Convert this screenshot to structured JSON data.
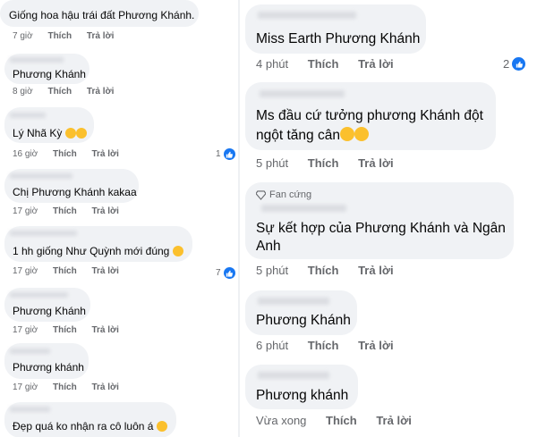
{
  "actions": {
    "like": "Thích",
    "reply": "Trả lời"
  },
  "left_comments": [
    {
      "text": "Giống hoa hậu trái đất Phương Khánh.",
      "time": "7 giờ"
    },
    {
      "text": "Phương Khánh",
      "time": "8 giờ"
    },
    {
      "text": "Lý Nhã Kỳ",
      "time": "16 giờ",
      "reactions": "1"
    },
    {
      "text": "Chị Phương Khánh kakaa",
      "time": "17 giờ"
    },
    {
      "text": "1 hh giống Như Quỳnh mới đúng",
      "time": "17 giờ",
      "reactions": "7"
    },
    {
      "text": "Phương Khánh",
      "time": "17 giờ"
    },
    {
      "text": "Phương khánh",
      "time": "17 giờ"
    },
    {
      "text": "Đẹp quá ko nhận ra cô luôn á",
      "time": ""
    }
  ],
  "right_comments": [
    {
      "text": "Miss Earth Phương Khánh",
      "time": "4 phút",
      "reactions": "2"
    },
    {
      "line1": "Ms đầu cứ tưởng phương Khánh đột",
      "line2": "ngột tăng cân",
      "time": "5 phút"
    },
    {
      "badge": "Fan cứng",
      "line1": "Sự kết hợp của Phương Khánh và Ngân",
      "line2": "Anh",
      "time": "5 phút"
    },
    {
      "text": "Phương Khánh",
      "time": "6 phút"
    },
    {
      "text": "Phương khánh",
      "time": "Vừa xong"
    }
  ],
  "icons": {
    "reaction": "like-icon",
    "badge": "diamond-icon",
    "emoji": "laughing-emoji"
  },
  "colors": {
    "bubble": "#f0f2f5",
    "meta": "#65676b",
    "like": "#1877f2"
  }
}
